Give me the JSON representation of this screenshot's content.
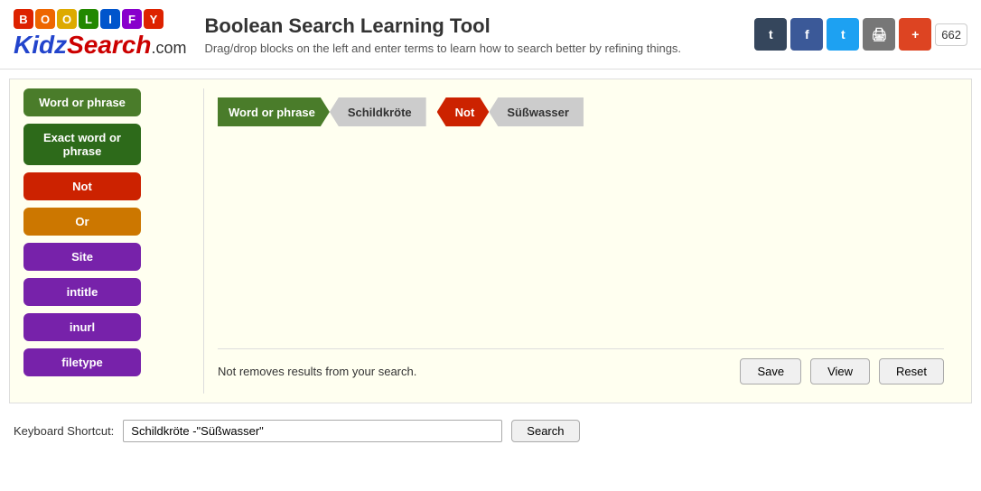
{
  "header": {
    "title": "Boolean Search Learning Tool",
    "description": "Drag/drop blocks on the left and enter terms to learn how to search better by refining things.",
    "logo_boolify": "BOOLIFY",
    "logo_letters": [
      {
        "letter": "B",
        "color": "#dd2200"
      },
      {
        "letter": "O",
        "color": "#ee6600"
      },
      {
        "letter": "O",
        "color": "#ddaa00"
      },
      {
        "letter": "L",
        "color": "#228800"
      },
      {
        "letter": "I",
        "color": "#0055cc"
      },
      {
        "letter": "F",
        "color": "#8800cc"
      },
      {
        "letter": "Y",
        "color": "#dd2200"
      }
    ],
    "social": {
      "tumblr_label": "t",
      "facebook_label": "f",
      "twitter_label": "t",
      "print_label": "🖨",
      "plus_label": "+",
      "count": "662"
    }
  },
  "sidebar": {
    "blocks": [
      {
        "label": "Word or phrase",
        "type": "green",
        "name": "word-or-phrase-block"
      },
      {
        "label": "Exact word or phrase",
        "type": "darkgreen",
        "name": "exact-word-block"
      },
      {
        "label": "Not",
        "type": "red",
        "name": "not-block"
      },
      {
        "label": "Or",
        "type": "orange",
        "name": "or-block"
      },
      {
        "label": "Site",
        "type": "purple",
        "name": "site-block"
      },
      {
        "label": "intitle",
        "type": "purple",
        "name": "intitle-block"
      },
      {
        "label": "inurl",
        "type": "purple",
        "name": "inurl-block"
      },
      {
        "label": "filetype",
        "type": "purple",
        "name": "filetype-block"
      }
    ]
  },
  "canvas": {
    "blocks": [
      {
        "type": "word",
        "label": "Word or phrase",
        "value": "Schildkröte"
      },
      {
        "type": "not",
        "label": "Not",
        "value": "Süßwasser"
      }
    ],
    "hint": "Not removes results from your search.",
    "save_label": "Save",
    "view_label": "View",
    "reset_label": "Reset"
  },
  "bottom": {
    "keyboard_shortcut_label": "Keyboard Shortcut:",
    "search_value": "Schildkröte -\"Süßwasser\"",
    "search_placeholder": "",
    "search_button_label": "Search"
  }
}
